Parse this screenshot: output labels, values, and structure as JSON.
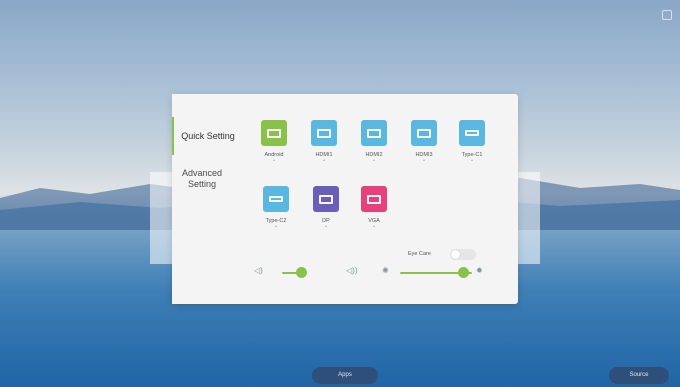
{
  "nav": {
    "quick_setting": "Quick Setting",
    "advanced_setting": "Advanced Setting"
  },
  "sources": [
    {
      "name": "Android",
      "color": "#8ac249",
      "icon": "android-tile-icon"
    },
    {
      "name": "HDMI1",
      "color": "#5ab8e0",
      "icon": "hdmi-icon"
    },
    {
      "name": "HDMI2",
      "color": "#5ab8e0",
      "icon": "hdmi-icon"
    },
    {
      "name": "HDMI3",
      "color": "#5ab8e0",
      "icon": "hdmi-icon"
    },
    {
      "name": "Type-C1",
      "color": "#5ab8e0",
      "icon": "usb-c-icon"
    },
    {
      "name": "Type-C2",
      "color": "#5ab8e0",
      "icon": "usb-c-icon"
    },
    {
      "name": "DP",
      "color": "#6a5fb8",
      "icon": "displayport-icon"
    },
    {
      "name": "VGA",
      "color": "#e6417a",
      "icon": "vga-icon"
    }
  ],
  "eye_care": {
    "label": "Eye Care",
    "on": false
  },
  "volume": {
    "level": 0.3
  },
  "brightness": {
    "level": 0.75
  },
  "accent_color": "#8ac249",
  "dock": {
    "apps_label": "Apps",
    "source_label": "Source"
  }
}
